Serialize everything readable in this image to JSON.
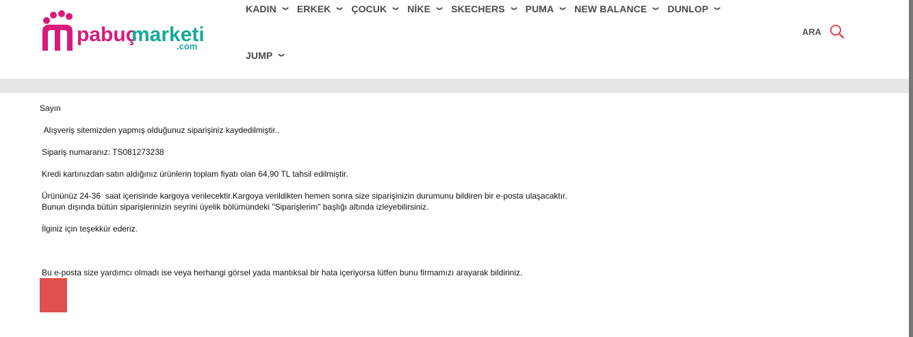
{
  "logo": {
    "text_main": "pabuçmarketi",
    "text_sub": ".com",
    "colors": {
      "pink": "#d81b7a",
      "teal": "#19a79a"
    }
  },
  "nav": {
    "row1": [
      {
        "label": "KADIN"
      },
      {
        "label": "ERKEK"
      },
      {
        "label": "ÇOCUK"
      },
      {
        "label": "NİKE"
      },
      {
        "label": "SKECHERS"
      },
      {
        "label": "PUMA"
      },
      {
        "label": "NEW BALANCE"
      },
      {
        "label": "DUNLOP"
      }
    ],
    "row2": [
      {
        "label": "JUMP"
      }
    ]
  },
  "search": {
    "label": "ARA",
    "icon": "search-icon",
    "color": "#e04848"
  },
  "message": {
    "greeting": "Sayın",
    "line1": " Alışveriş sitemizden yapmış olduğunuz siparişiniz kaydedilmiştir..",
    "line2": "Sipariş numaranız: TS081273238",
    "line3": "Kredi kartınızdan satın aldığınız ürünlerin toplam fiyatı olan 64,90 TL tahsil edilmiştir.",
    "line4a": "Ürününüz 24-36  saat içerisinde kargoya verilecektir.Kargoya verildikten hemen sonra size siparişinizin durumunu bildiren bir e-posta ulaşacaktır.",
    "line4b": "Bunun dışında bütün siparişlerinizin seyrini üyelik bölümündeki \"Siparişlerim\" başlığı altında izleyebilirsiniz.",
    "line5": "İlginiz için teşekkür ederiz.",
    "footer": "Bu e-posta size yardımcı olmadı ise veya herhangi görsel yada mantıksal bir hata içeriyorsa lütfen bunu firmamızı arayarak bildiriniz."
  },
  "accent_box_color": "#e05050"
}
